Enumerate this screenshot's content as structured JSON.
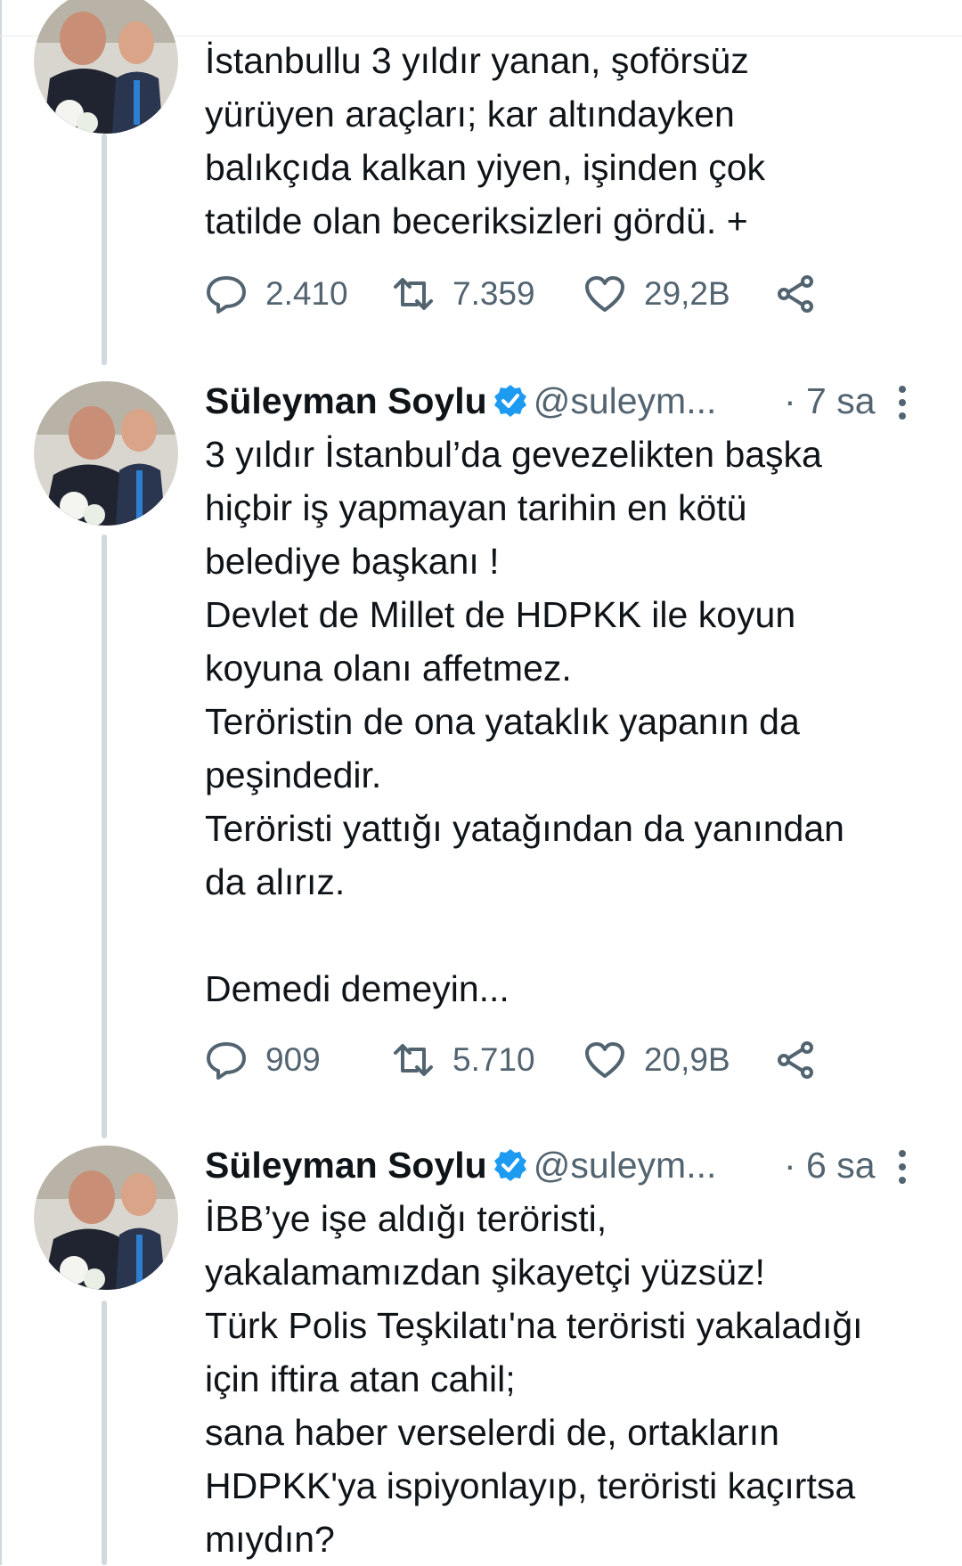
{
  "tweets": [
    {
      "body": "İstanbullu 3 yıldır yanan, şoförsüz\nyürüyen araçları; kar altındayken\nbalıkçıda kalkan yiyen, işinden çok\ntatilde olan beceriksizleri gördü. +",
      "replies": "2.410",
      "retweets": "7.359",
      "likes": "29,2B"
    },
    {
      "name": "Süleyman Soylu",
      "handle": "@suleym...",
      "time": "· 7 sa",
      "body": "3 yıldır İstanbul’da gevezelikten başka\nhiçbir iş yapmayan tarihin en kötü\nbelediye başkanı !\nDevlet de Millet de HDPKK ile koyun\nkoyuna olanı affetmez.\nTeröristin de ona yataklık yapanın da\npeşindedir.\nTeröristi yattığı yatağından da yanından\nda alırız.\n\nDemedi demeyin...",
      "replies": "909",
      "retweets": "5.710",
      "likes": "20,9B"
    },
    {
      "name": "Süleyman Soylu",
      "handle": "@suleym...",
      "time": "· 6 sa",
      "body": "İBB’ye işe aldığı teröristi,\nyakalamamızdan şikayetçi yüzsüz!\nTürk Polis Teşkilatı'na teröristi yakaladığı\niçin iftira atan cahil;\nsana haber verselerdi de, ortakların\nHDPKK'ya ispiyonlayıp, teröristi kaçırtsa\nmıydın?"
    }
  ],
  "colors": {
    "verified": "#1d9bf0",
    "muted": "#536471",
    "thread_line": "#cfd9de"
  },
  "icons": [
    "reply-icon",
    "retweet-icon",
    "like-icon",
    "share-icon",
    "verified-badge-icon",
    "more-icon"
  ]
}
